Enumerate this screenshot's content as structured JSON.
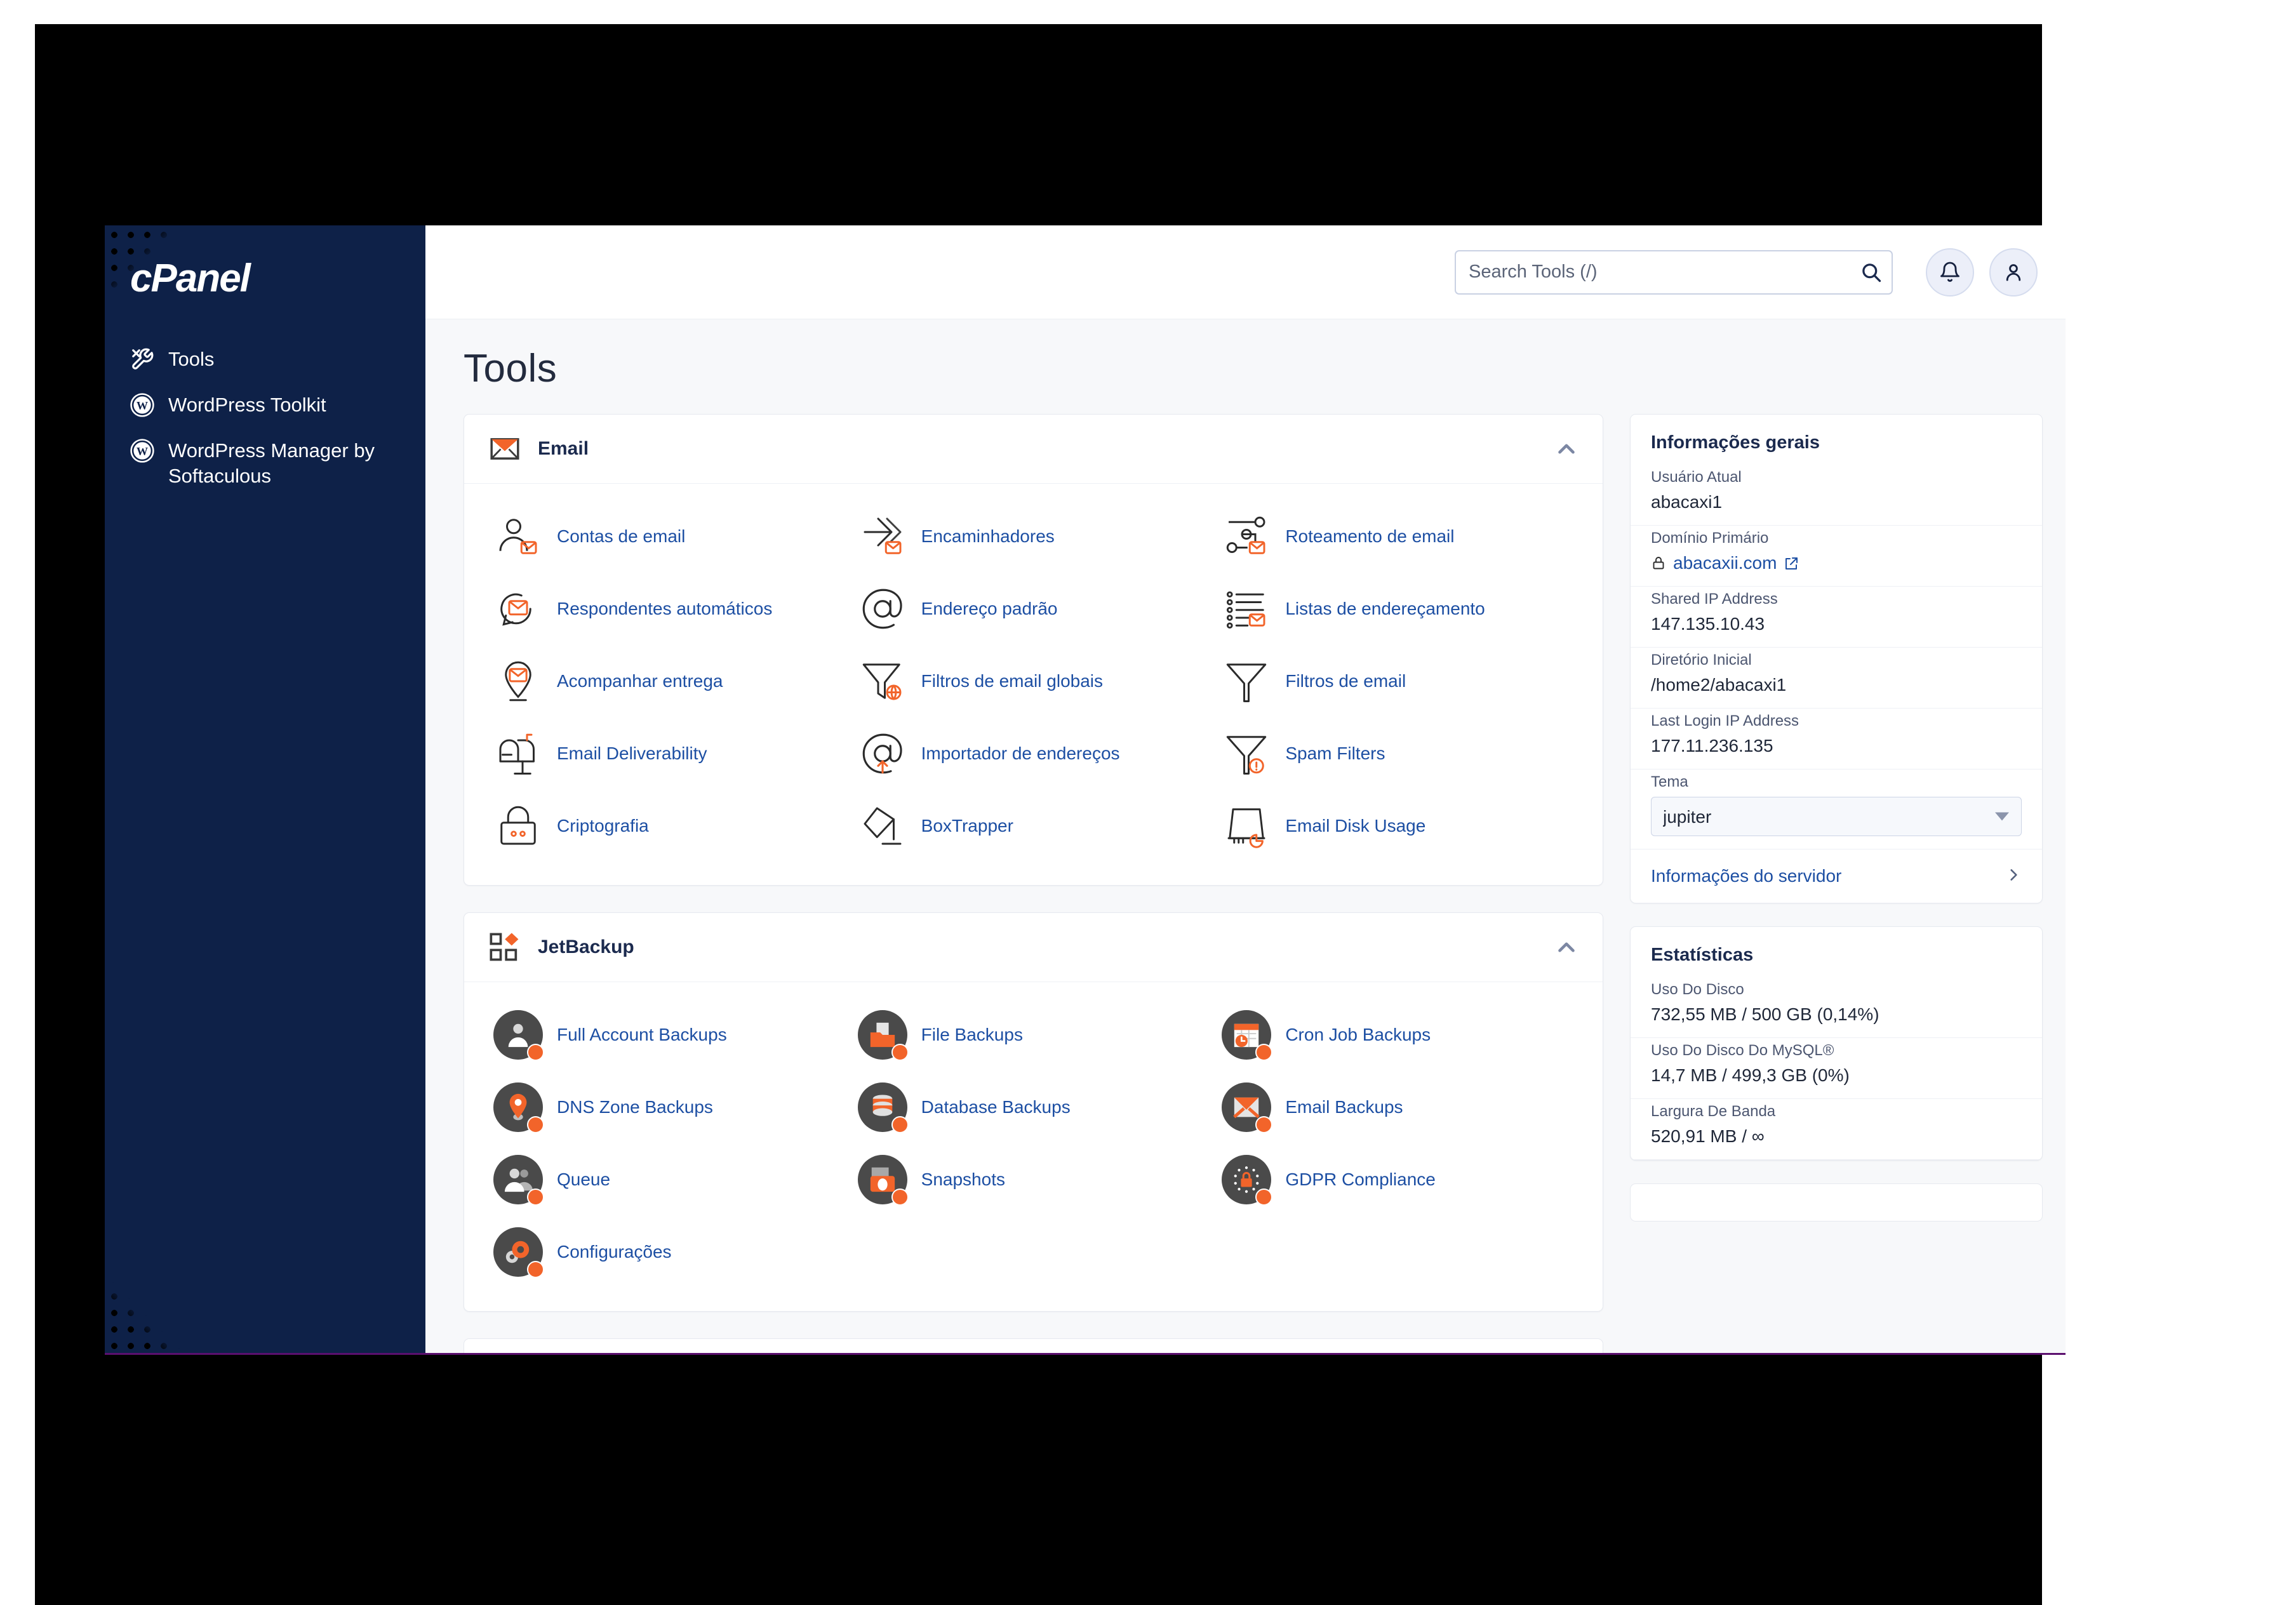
{
  "brand": {
    "name": "cPanel"
  },
  "sidebar": {
    "items": [
      {
        "label": "Tools",
        "icon": "tools-icon"
      },
      {
        "label": "WordPress Toolkit",
        "icon": "wordpress-icon"
      },
      {
        "label": "WordPress Manager by Softaculous",
        "icon": "wordpress-icon"
      }
    ]
  },
  "topbar": {
    "search_placeholder": "Search Tools (/)",
    "search_value": "",
    "search_icon": "search-icon",
    "notifications_icon": "bell-icon",
    "account_icon": "user-icon"
  },
  "main": {
    "page_title": "Tools",
    "sections": [
      {
        "id": "email",
        "title": "Email",
        "icon": "envelope-icon",
        "collapse_icon": "chevron-up-icon",
        "style": "line",
        "items": [
          {
            "label": "Contas de email",
            "icon": "user-mail-icon"
          },
          {
            "label": "Encaminhadores",
            "icon": "forward-arrow-icon"
          },
          {
            "label": "Roteamento de email",
            "icon": "routing-icon"
          },
          {
            "label": "Respondentes automáticos",
            "icon": "autoresponder-icon"
          },
          {
            "label": "Endereço padrão",
            "icon": "at-sign-icon"
          },
          {
            "label": "Listas de endereçamento",
            "icon": "mailing-list-icon"
          },
          {
            "label": "Acompanhar entrega",
            "icon": "delivery-pin-icon"
          },
          {
            "label": "Filtros de email globais",
            "icon": "global-filter-icon"
          },
          {
            "label": "Filtros de email",
            "icon": "filter-icon"
          },
          {
            "label": "Email Deliverability",
            "icon": "mailbox-icon"
          },
          {
            "label": "Importador de endereços",
            "icon": "at-import-icon"
          },
          {
            "label": "Spam Filters",
            "icon": "spam-filter-icon"
          },
          {
            "label": "Criptografia",
            "icon": "lock-icon"
          },
          {
            "label": "BoxTrapper",
            "icon": "boxtrapper-icon"
          },
          {
            "label": "Email Disk Usage",
            "icon": "disk-usage-icon"
          }
        ]
      },
      {
        "id": "jetbackup",
        "title": "JetBackup",
        "icon": "jetbackup-icon",
        "collapse_icon": "chevron-up-icon",
        "style": "circle",
        "items": [
          {
            "label": "Full Account Backups",
            "icon": "account-icon"
          },
          {
            "label": "File Backups",
            "icon": "file-folder-icon"
          },
          {
            "label": "Cron Job Backups",
            "icon": "calendar-clock-icon"
          },
          {
            "label": "DNS Zone Backups",
            "icon": "map-pin-icon"
          },
          {
            "label": "Database Backups",
            "icon": "database-icon"
          },
          {
            "label": "Email Backups",
            "icon": "envelope-solid-icon"
          },
          {
            "label": "Queue",
            "icon": "people-icon"
          },
          {
            "label": "Snapshots",
            "icon": "camera-icon"
          },
          {
            "label": "GDPR Compliance",
            "icon": "gdpr-lock-icon"
          },
          {
            "label": "Configurações",
            "icon": "gears-icon"
          }
        ]
      }
    ]
  },
  "right_panel": {
    "general": {
      "title": "Informações gerais",
      "rows": [
        {
          "label": "Usuário Atual",
          "value": "abacaxi1",
          "type": "text"
        },
        {
          "label": "Domínio Primário",
          "value": "abacaxii.com",
          "type": "link",
          "lock_icon": "lock-icon",
          "external_icon": "external-link-icon"
        },
        {
          "label": "Shared IP Address",
          "value": "147.135.10.43",
          "type": "text"
        },
        {
          "label": "Diretório Inicial",
          "value": "/home2/abacaxi1",
          "type": "text"
        },
        {
          "label": "Last Login IP Address",
          "value": "177.11.236.135",
          "type": "text"
        },
        {
          "label": "Tema",
          "value": "jupiter",
          "type": "select",
          "options": [
            "jupiter"
          ]
        }
      ],
      "server_info_label": "Informações do servidor",
      "server_info_icon": "chevron-right-icon"
    },
    "stats": {
      "title": "Estatísticas",
      "rows": [
        {
          "label": "Uso Do Disco",
          "value": "732,55 MB / 500 GB   (0,14%)"
        },
        {
          "label": "Uso Do Disco Do MySQL®",
          "value": "14,7 MB / 499,3 GB   (0%)"
        },
        {
          "label": "Largura De Banda",
          "value": "520,91 MB / ∞"
        }
      ]
    }
  },
  "colors": {
    "sidebar_bg": "#0e2148",
    "accent_orange": "#f2642a",
    "link_blue": "#1d4fa3",
    "page_bg": "#f7f8fa",
    "bottom_rule": "#5b0f6e"
  }
}
